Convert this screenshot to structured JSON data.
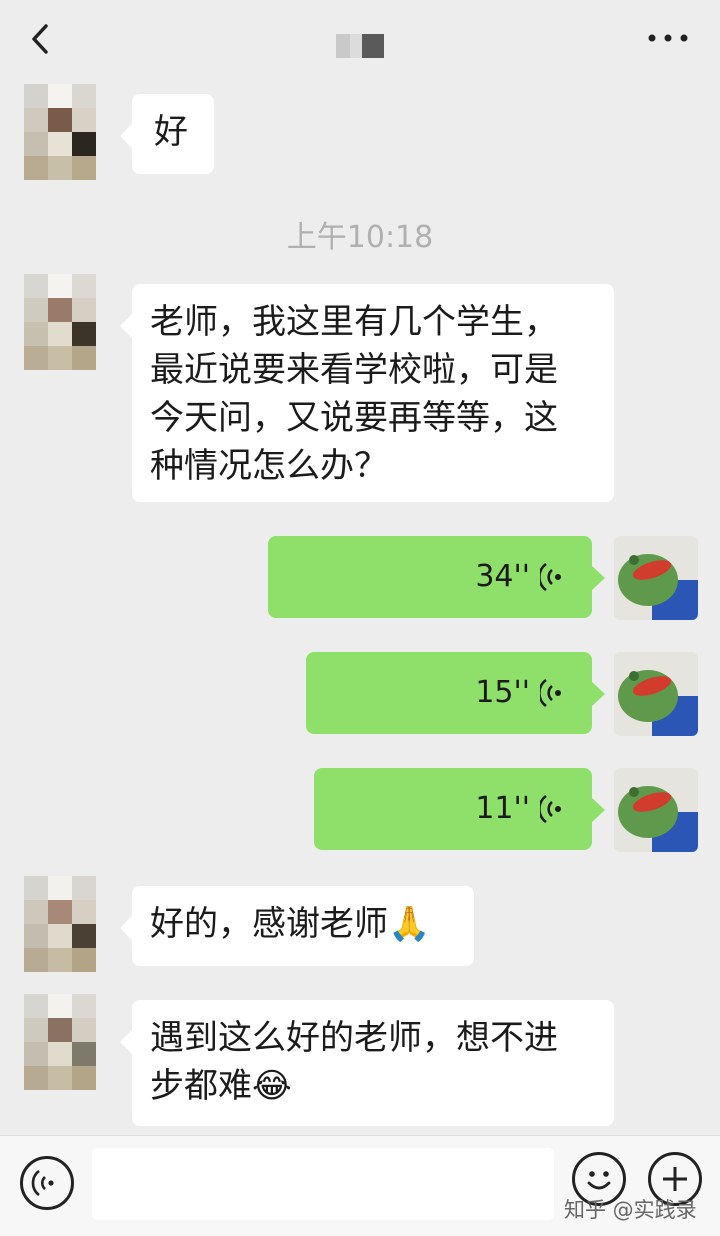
{
  "header": {
    "back_icon": "chevron-left-icon",
    "more_icon": "more-horizontal-icon"
  },
  "messages": [
    {
      "side": "left",
      "text": "好"
    },
    {
      "type": "time",
      "text": "上午10:18"
    },
    {
      "side": "left",
      "lines": [
        "老师，我这里有几个学生，",
        "最近说要来看学校啦，可是",
        "今天问，又说要再等等，这",
        "种情况怎么办？"
      ]
    },
    {
      "side": "right",
      "type": "voice",
      "duration": "34''"
    },
    {
      "side": "right",
      "type": "voice",
      "duration": "15''"
    },
    {
      "side": "right",
      "type": "voice",
      "duration": "11''"
    },
    {
      "side": "left",
      "text": "好的，感谢老师🙏"
    },
    {
      "side": "left",
      "lines": [
        "遇到这么好的老师，想不进",
        "步都难😂"
      ]
    }
  ],
  "bottom": {
    "voice_icon": "voice-input-icon",
    "emoji_icon": "emoji-icon",
    "plus_icon": "plus-icon"
  },
  "watermark": "知乎 @实践录",
  "colors": {
    "background": "#ededed",
    "bubble_self": "#8fe06a",
    "bubble_other": "#ffffff"
  }
}
